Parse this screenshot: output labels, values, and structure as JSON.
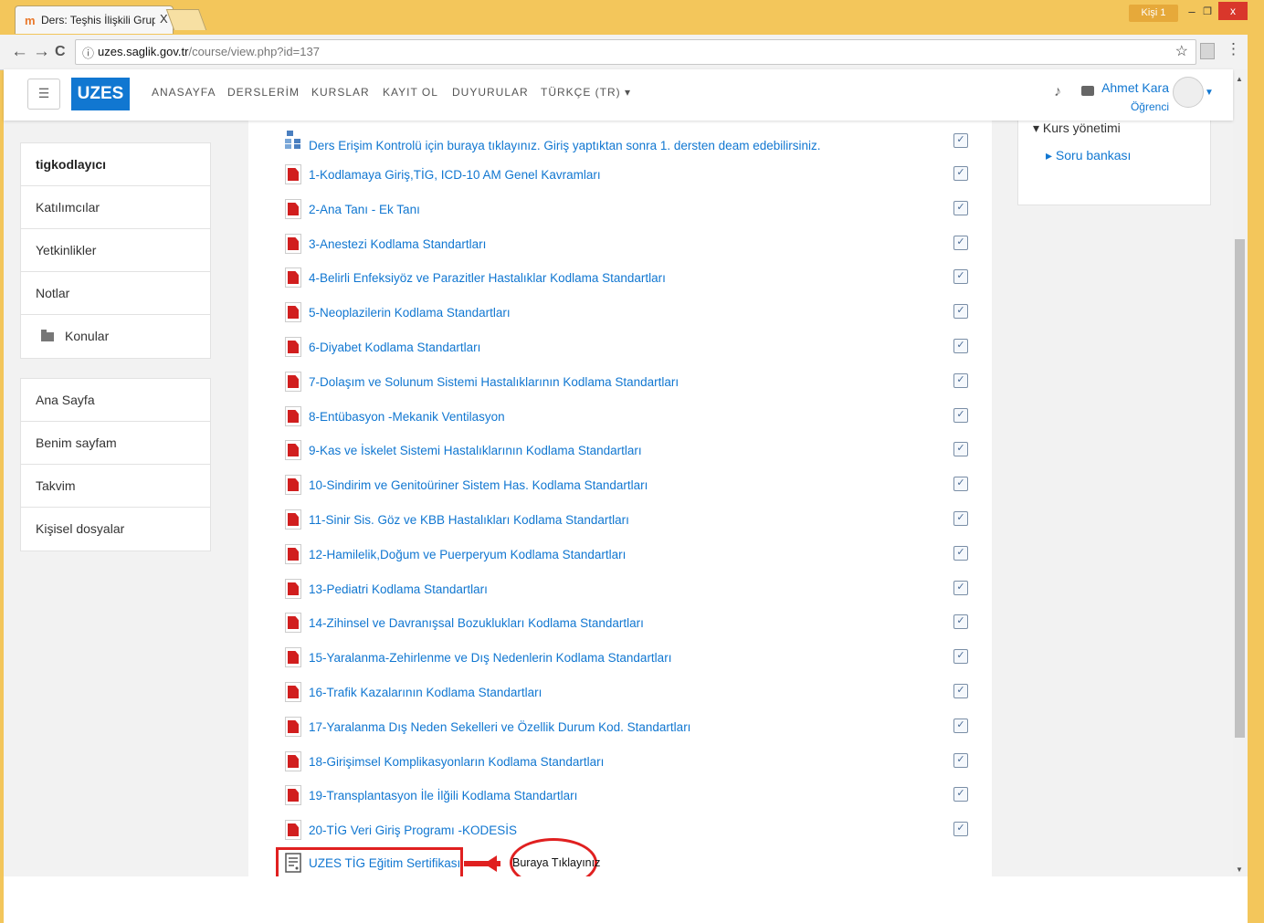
{
  "browser": {
    "tab_title": "Ders: Teşhis İlişkili Grupla",
    "tab_close": "X",
    "profile_label": "Kişi 1",
    "url_host": "uzes.saglik.gov.tr",
    "url_path": "/course/view.php?id=137",
    "back": "←",
    "forward": "→",
    "reload": "C",
    "star": "☆",
    "menu": "⋮",
    "minimize": "–",
    "restore": "❐",
    "close": "x"
  },
  "navbar": {
    "brand": "UZES",
    "links": [
      "ANASAYFA",
      "DERSLERİM",
      "KURSLAR",
      "KAYIT OL",
      "DUYURULAR",
      "TÜRKÇE (TR) ▾"
    ],
    "user_name": "Ahmet Kara",
    "user_role": "Öğrenci"
  },
  "left_nav": {
    "course_items": [
      "tigkodlayıcı",
      "Katılımcılar",
      "Yetkinlikler",
      "Notlar",
      "Konular"
    ],
    "site_items": [
      "Ana Sayfa",
      "Benim sayfam",
      "Takvim",
      "Kişisel dosyalar"
    ]
  },
  "right_block": {
    "section": "▾ Kurs yönetimi",
    "item": "▸ Soru bankası"
  },
  "activities": [
    "Ders Erişim Kontrolü için buraya tıklayınız. Giriş yaptıktan sonra 1. dersten deam edebilirsiniz.",
    "1-Kodlamaya Giriş,TİG, ICD-10 AM Genel Kavramları",
    "2-Ana Tanı - Ek Tanı",
    "3-Anestezi Kodlama Standartları",
    "4-Belirli Enfeksiyöz ve Parazitler Hastalıklar Kodlama Standartları",
    "5-Neoplazilerin Kodlama Standartları",
    "6-Diyabet Kodlama Standartları",
    "7-Dolaşım ve Solunum Sistemi Hastalıklarının Kodlama Standartları",
    "8-Entübasyon -Mekanik Ventilasyon",
    "9-Kas ve İskelet Sistemi Hastalıklarının Kodlama Standartları",
    "10-Sindirim ve Genitoüriner Sistem Has. Kodlama Standartları",
    "11-Sinir Sis. Göz ve KBB Hastalıkları Kodlama Standartları",
    "12-Hamilelik,Doğum ve Puerperyum Kodlama Standartları",
    "13-Pediatri Kodlama Standartları",
    "14-Zihinsel ve Davranışsal Bozuklukları Kodlama Standartları",
    "15-Yaralanma-Zehirlenme ve Dış Nedenlerin Kodlama Standartları",
    "16-Trafik Kazalarının Kodlama Standartları",
    "17-Yaralanma Dış Neden Sekelleri ve Özellik Durum Kod. Standartları",
    "18-Girişimsel Komplikasyonların Kodlama Standartları",
    "19-Transplantasyon İle İlğili Kodlama Standartları",
    "20-TİG Veri Giriş Programı -KODESİS"
  ],
  "certificate": {
    "label": "UZES TİG Eğitim Sertifikası",
    "callout": "Buraya Tıklayınız"
  },
  "colors": {
    "window_frame": "#f3c65b",
    "brand_blue": "#1177d1",
    "annotation_red": "#e02020"
  }
}
